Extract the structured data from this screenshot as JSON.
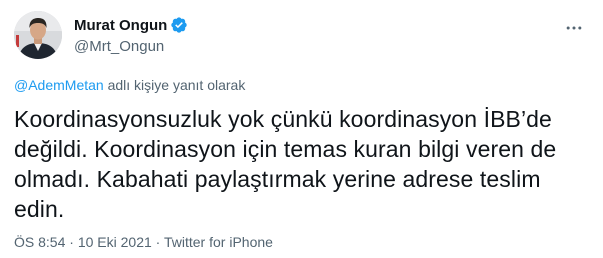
{
  "author": {
    "display_name": "Murat Ongun",
    "handle": "@Mrt_Ongun",
    "verified": true
  },
  "icons": {
    "verified": "verified-badge-icon",
    "more": "more-options-icon",
    "avatar": "profile-photo"
  },
  "reply": {
    "mention": "@AdemMetan",
    "suffix": " adlı kişiye yanıt olarak"
  },
  "tweet": {
    "lines": [
      "Koordinasyonsuzluk yok çünkü koordinasyon İBB’de",
      "değildi. Koordinasyon için temas kuran bilgi veren de",
      "olmadı. Kabahati paylaştırmak yerine adrese teslim",
      "edin."
    ]
  },
  "meta": {
    "time": "ÖS 8:54",
    "separator": " · ",
    "date": "10 Eki 2021",
    "separator2": " · ",
    "source": "Twitter for iPhone"
  },
  "colors": {
    "text": "#0f1419",
    "secondary": "#536471",
    "link": "#1d9bf0",
    "verified": "#1d9bf0"
  }
}
